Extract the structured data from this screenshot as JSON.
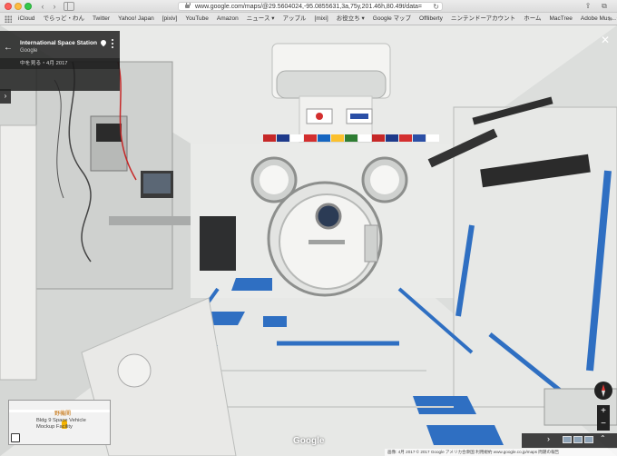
{
  "browser": {
    "url": "www.google.com/maps/@29.5604024,-95.0855631,3a,75y,201.46h,80.49t/data=",
    "bookmarks": [
      "iCloud",
      "でらっど・わん",
      "Twitter",
      "Yahoo! Japan",
      "[pixiv]",
      "YouTube",
      "Amazon",
      "ニュース ▾",
      "アップル",
      "[mixi]",
      "お役立ち ▾",
      "Google マップ",
      "Offliberty",
      "ニンテンドーアカウント",
      "ホーム",
      "MacTree",
      "Adobe Mus…ーディオの追加"
    ],
    "more_label": "»"
  },
  "street_view": {
    "title": "International Space Station",
    "subtitle": "Google",
    "date_label": "中を見る・4月 2017",
    "close_label": "✕",
    "back_label": "←",
    "side_arrow": "›",
    "google_logo": "Google",
    "footer": "画像: 4月 2017 © 2017 Google アメリカ合衆国 利用規約 www.google.co.jp/maps 問題の報告",
    "zoom_in": "+",
    "zoom_out": "−",
    "strip_arrow": "›",
    "strip_up": "⌃"
  },
  "minimap": {
    "label_jp": "野機関",
    "label": "Bldg 9 Space Vehicle\nMockup Facility"
  },
  "colors": {
    "module_wall": "#e3e4e2",
    "handrail_blue": "#2f6fc2",
    "hatch_white": "#f4f4f2",
    "panel_dark": "#2b2b2b"
  }
}
